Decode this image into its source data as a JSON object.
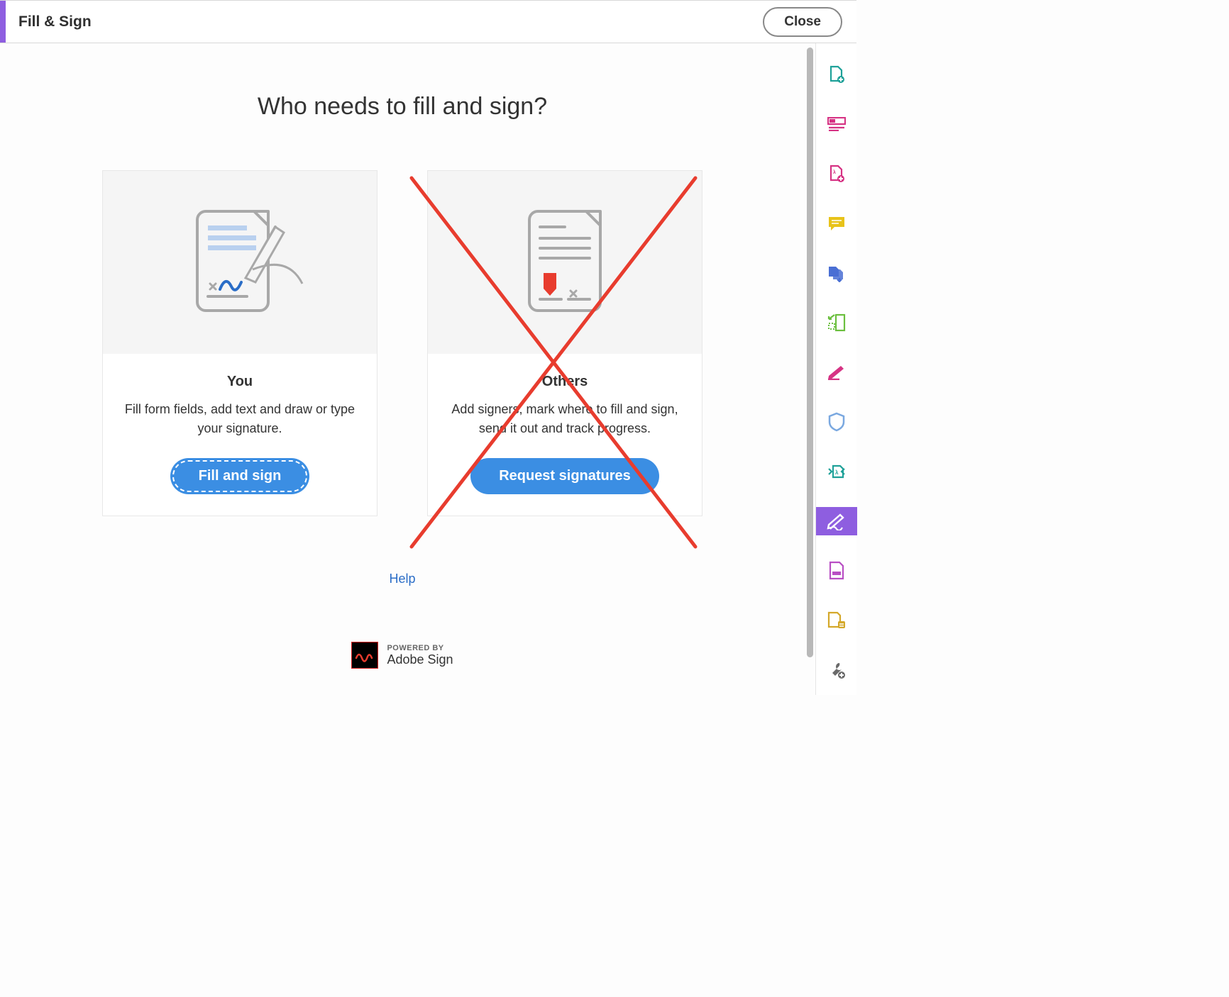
{
  "header": {
    "title": "Fill & Sign",
    "close_label": "Close"
  },
  "heading": "Who needs to fill and sign?",
  "cards": {
    "you": {
      "title": "You",
      "desc": "Fill form fields, add text and draw or type your signature.",
      "button": "Fill and sign"
    },
    "others": {
      "title": "Others",
      "desc": "Add signers, mark where to fill and sign, send it out and track progress.",
      "button": "Request signatures"
    }
  },
  "help_label": "Help",
  "powered": {
    "small": "POWERED BY",
    "big": "Adobe Sign"
  },
  "rail_icons": [
    "export-pdf-icon",
    "layout-icon",
    "create-pdf-icon",
    "comment-icon",
    "combine-icon",
    "measure-icon",
    "sign-pen-icon",
    "protect-icon",
    "compress-icon",
    "fill-sign-icon",
    "redact-icon",
    "compare-icon",
    "tools-icon"
  ],
  "colors": {
    "accent": "#8e5ee0",
    "button_blue": "#3b8ee3",
    "annotate_red": "#e83c2e"
  }
}
